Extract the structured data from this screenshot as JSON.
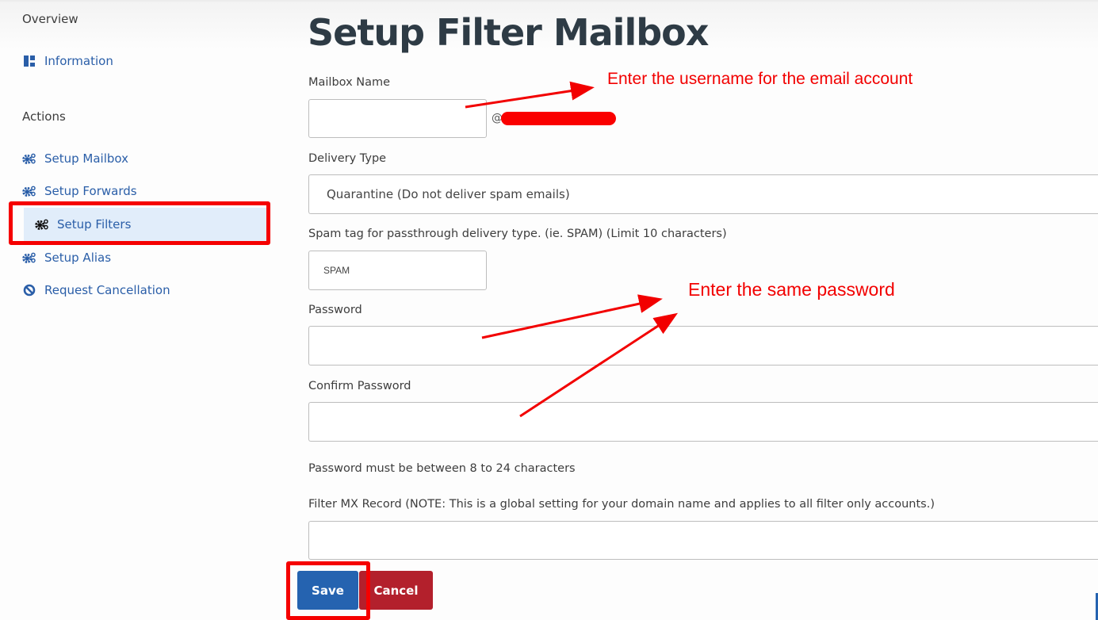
{
  "sidebar": {
    "overview_title": "Overview",
    "overview_items": [
      {
        "label": "Information",
        "icon": "dashboard-icon"
      }
    ],
    "actions_title": "Actions",
    "actions_items": [
      {
        "label": "Setup Mailbox",
        "icon": "cogs-icon"
      },
      {
        "label": "Setup Forwards",
        "icon": "cogs-icon"
      },
      {
        "label": "Setup Filters",
        "icon": "cogs-icon",
        "active": true
      },
      {
        "label": "Setup Alias",
        "icon": "cogs-icon"
      },
      {
        "label": "Request Cancellation",
        "icon": "ban-icon"
      }
    ]
  },
  "form": {
    "title": "Setup Filter Mailbox",
    "mailbox_name_label": "Mailbox Name",
    "mailbox_name_value": "",
    "domain_prefix": "@",
    "delivery_type_label": "Delivery Type",
    "delivery_type_value": "Quarantine (Do not deliver spam emails)",
    "spam_tag_label": "Spam tag for passthrough delivery type. (ie. SPAM) (Limit 10 characters)",
    "spam_tag_value": "SPAM",
    "password_label": "Password",
    "password_value": "",
    "confirm_password_label": "Confirm Password",
    "confirm_password_value": "",
    "password_hint": "Password must be between 8 to 24 characters",
    "mx_record_label": "Filter MX Record (NOTE: This is a global setting for your domain name and applies to all filter only accounts.)",
    "mx_record_value": "",
    "save_label": "Save",
    "cancel_label": "Cancel"
  },
  "annotations": {
    "username_note": "Enter the username for the email account",
    "password_note": "Enter the same password"
  },
  "colors": {
    "link": "#2a5ea8",
    "active_bg": "#e1edfa",
    "save": "#2563b0",
    "cancel": "#b3202c",
    "annotation": "#f20000"
  }
}
